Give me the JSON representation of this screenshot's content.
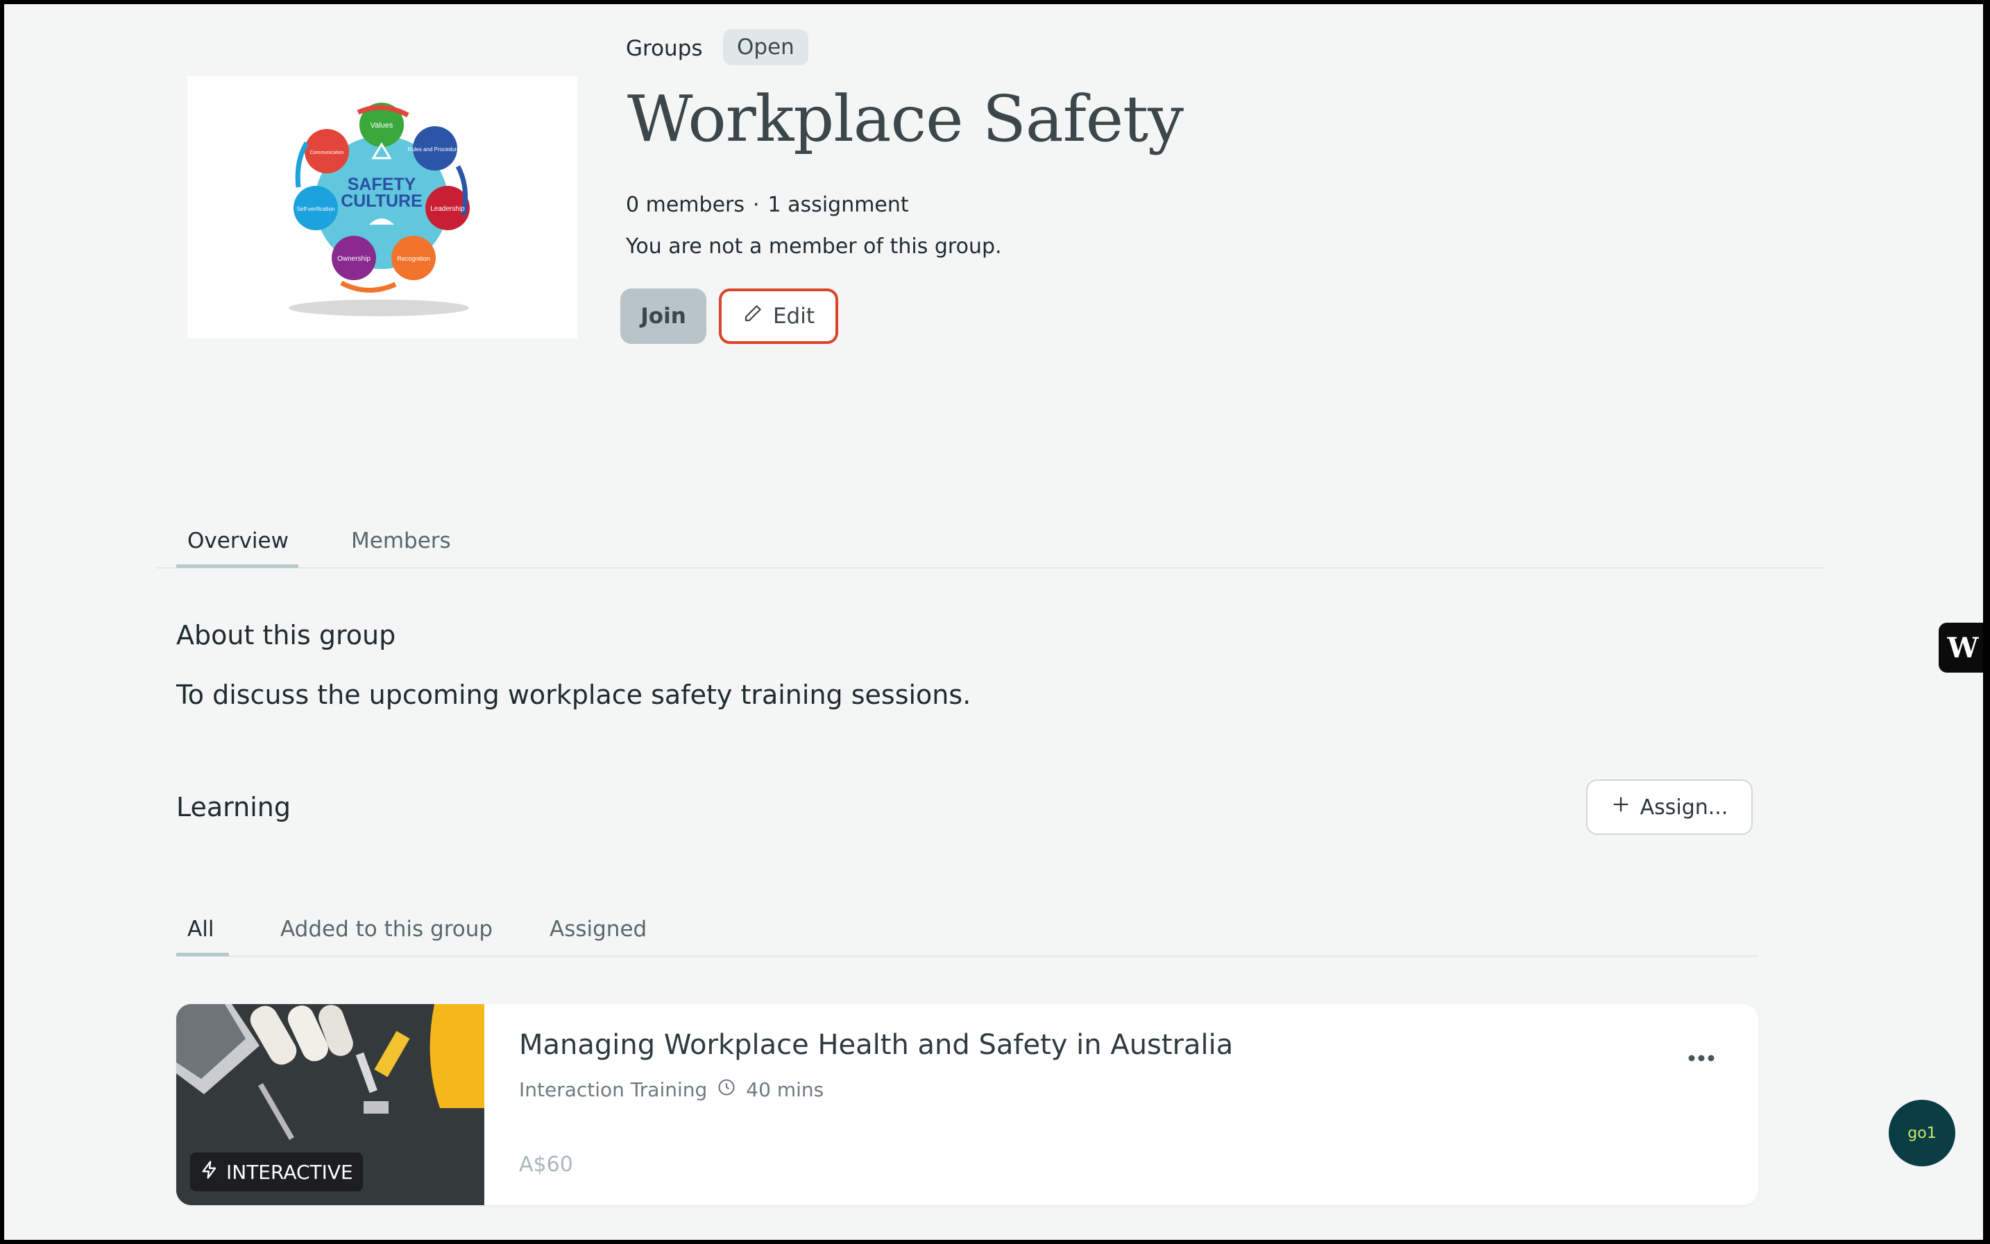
{
  "header": {
    "breadcrumb": "Groups",
    "status_badge": "Open",
    "title": "Workplace Safety",
    "members_count": "0 members",
    "meta_separator": "·",
    "assignments_count": "1 assignment",
    "membership_text": "You are not a member of this group.",
    "join_label": "Join",
    "edit_label": "Edit",
    "thumbnail": {
      "center_line1": "SAFETY",
      "center_line2": "CULTURE",
      "labels": [
        "Values",
        "Rules and Procedures",
        "Leadership",
        "Recognition",
        "Ownership",
        "Self-verification",
        "Communication"
      ]
    }
  },
  "tabs": [
    {
      "label": "Overview",
      "active": true
    },
    {
      "label": "Members",
      "active": false
    }
  ],
  "about": {
    "heading": "About this group",
    "description": "To discuss the upcoming workplace safety training sessions."
  },
  "learning": {
    "heading": "Learning",
    "assign_label": "Assign...",
    "filters": [
      {
        "label": "All",
        "active": true
      },
      {
        "label": "Added to this group",
        "active": false
      },
      {
        "label": "Assigned",
        "active": false
      }
    ],
    "items": [
      {
        "title": "Managing Workplace Health and Safety in Australia",
        "provider": "Interaction Training",
        "duration": "40 mins",
        "price": "A$60",
        "badge": "INTERACTIVE"
      }
    ]
  },
  "widgets": {
    "side_tab_label": "W",
    "chat_label": "go1"
  },
  "colors": {
    "background": "#f4f6f6",
    "edit_outline": "#d9442b",
    "join_bg": "#b9c4c8",
    "chat_bg": "#0b3d45"
  }
}
